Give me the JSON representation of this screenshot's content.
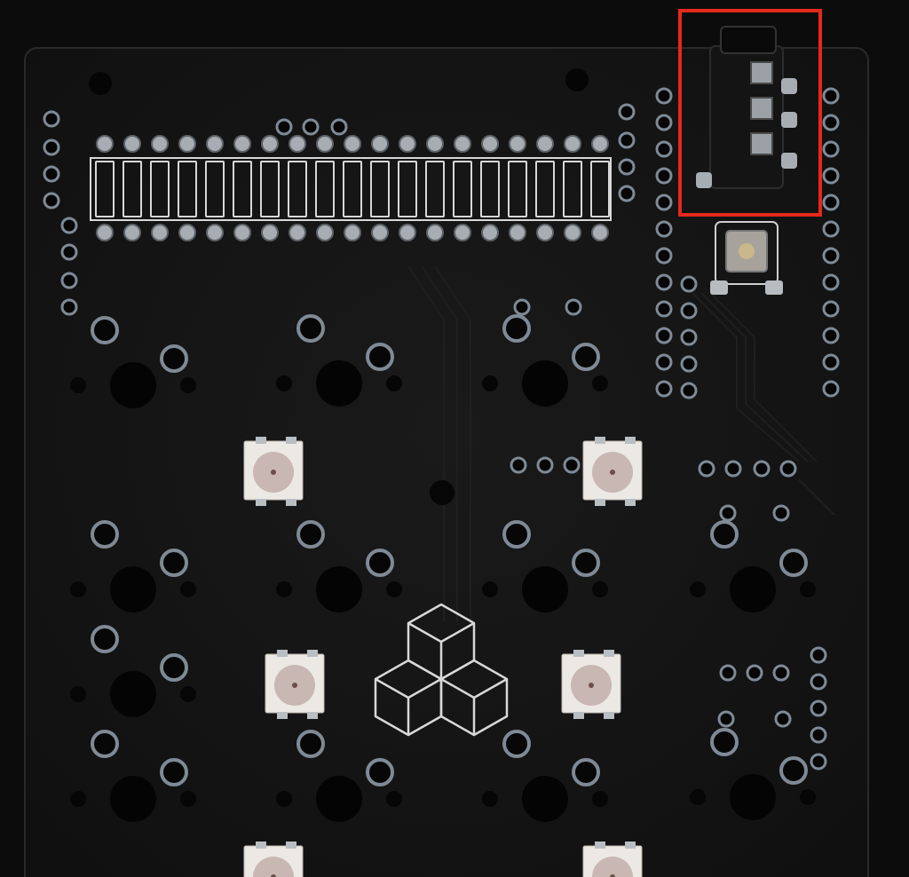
{
  "photo": {
    "subject": "pcb-keyboard-board",
    "colors": {
      "background": "#0c0c0c",
      "board": "#151515",
      "board_edge": "#2a2a2a",
      "pad_ring": "#7f8a96",
      "silkscreen": "#d8d8d8",
      "led_body": "#ece9e4",
      "led_lens": "#c8b7b2",
      "highlight_box": "#e4291b"
    }
  },
  "annotation": {
    "kind": "highlight-box",
    "color": "#e4291b"
  }
}
